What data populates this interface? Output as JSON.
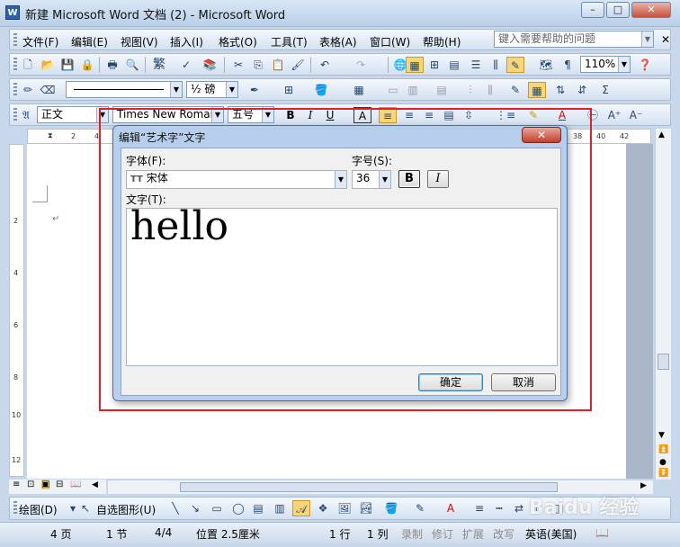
{
  "window": {
    "title": "新建 Microsoft Word 文档 (2) - Microsoft Word",
    "icon": "W",
    "controls": [
      "–",
      "□",
      "✕"
    ]
  },
  "menu": {
    "items": [
      "文件(F)",
      "编辑(E)",
      "视图(V)",
      "插入(I)",
      "格式(O)",
      "工具(T)",
      "表格(A)",
      "窗口(W)",
      "帮助(H)"
    ],
    "help_placeholder": "键入需要帮助的问题"
  },
  "standard_toolbar": {
    "zoom": "110%",
    "trad_label": "繁"
  },
  "tables_toolbar": {
    "line_weight": "½ 磅"
  },
  "format_toolbar": {
    "style": "正文",
    "font": "Times New Roman",
    "size": "五号",
    "bold": "B",
    "italic": "I",
    "underline": "U",
    "font_color": "A"
  },
  "ruler": {
    "h_ticks": [
      "2",
      "4",
      "38",
      "40",
      "42"
    ],
    "v_ticks": [
      "2",
      "4",
      "6",
      "8",
      "10",
      "12"
    ]
  },
  "dialog": {
    "title": "编辑“艺术字”文字",
    "close": "✕",
    "font_label": "字体(F):",
    "font_value": "宋体",
    "font_icon": "TT",
    "size_label": "字号(S):",
    "size_value": "36",
    "bold": "B",
    "italic": "I",
    "text_label": "文字(T):",
    "text_value": "hello",
    "ok": "确定",
    "cancel": "取消"
  },
  "drawing_toolbar": {
    "draw_label": "绘图(D)",
    "autoshape_label": "自选图形(U)"
  },
  "status_bar": {
    "page": "4 页",
    "section": "1 节",
    "page_of": "4/4",
    "position": "位置 2.5厘米",
    "line": "1 行",
    "column": "1 列",
    "rec": "录制",
    "trk": "修订",
    "ext": "扩展",
    "ovr": "改写",
    "lang": "英语(美国)"
  },
  "watermark": "Baidu 经验",
  "colors": {
    "annotation": "#e0212b",
    "accent": "#2b5fb4"
  }
}
